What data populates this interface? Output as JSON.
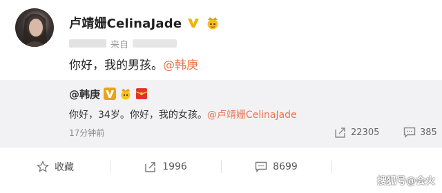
{
  "post": {
    "author": "卢靖姗CelinaJade",
    "source_prefix": "来自",
    "text": "你好，我的男孩。",
    "mention": "@韩庚"
  },
  "repost": {
    "author": "@韩庚",
    "text_before": "你好，34岁。你好，我的女孩。",
    "mention": "@卢靖姗CelinaJade",
    "time": "17分钟前",
    "reposts": "22305",
    "comments": "385"
  },
  "actions": {
    "favorite": "收藏",
    "repost_count": "1996",
    "comment_count": "8699"
  },
  "watermark": "搜狐号@会火",
  "colors": {
    "mention": "#eb7350",
    "vip_gold": "#f0b400",
    "repost_bg": "#f2f2f5"
  },
  "icons": [
    "avatar",
    "vip-v-icon",
    "crown-icon",
    "red-envelope-icon",
    "repost-icon",
    "comment-icon",
    "star-icon"
  ]
}
